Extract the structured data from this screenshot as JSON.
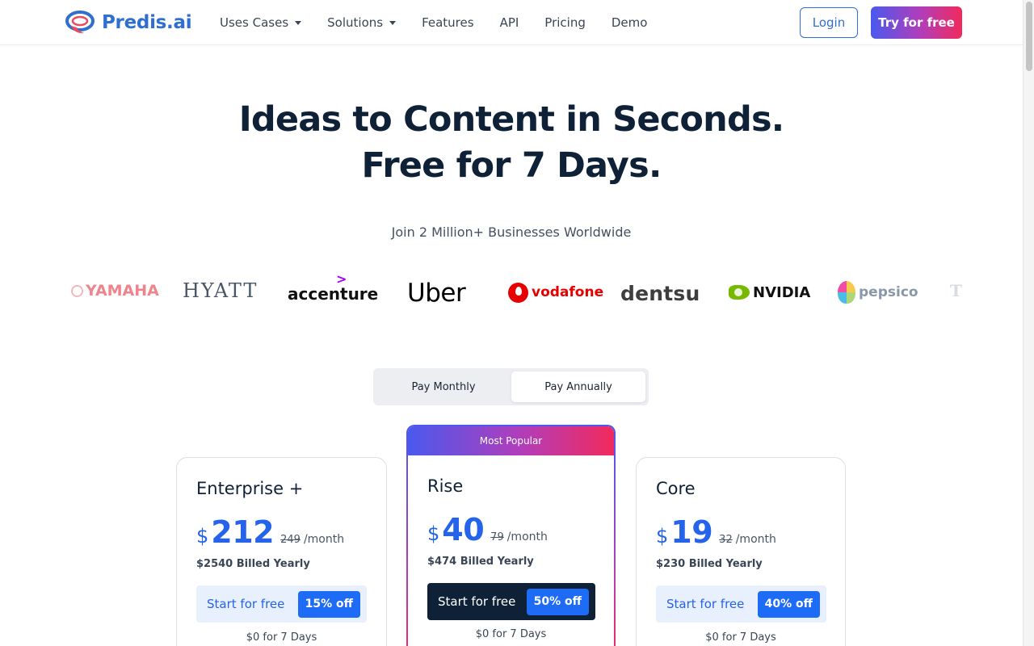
{
  "header": {
    "logo_text": "Predis.ai",
    "nav": [
      {
        "label": "Uses Cases",
        "dropdown": true
      },
      {
        "label": "Solutions",
        "dropdown": true
      },
      {
        "label": "Features",
        "dropdown": false
      },
      {
        "label": "API",
        "dropdown": false
      },
      {
        "label": "Pricing",
        "dropdown": false
      },
      {
        "label": "Demo",
        "dropdown": false
      }
    ],
    "login_label": "Login",
    "try_label": "Try for free"
  },
  "hero": {
    "title_line1": "Ideas to Content in Seconds.",
    "title_line2": "Free for 7 Days.",
    "subtitle": "Join 2 Million+ Businesses Worldwide"
  },
  "brands": {
    "yamaha": "YAMAHA",
    "hyatt": "HYATT",
    "accenture": "accenture",
    "uber": "Uber",
    "vodafone": "vodafone",
    "dentsu": "dentsu",
    "nvidia": "NVIDIA",
    "pepsico": "pepsico",
    "partial": "T"
  },
  "billing": {
    "monthly_label": "Pay Monthly",
    "annual_label": "Pay Annually",
    "selected": "Pay Annually"
  },
  "plans": {
    "enterprise": {
      "name": "Enterprise +",
      "currency": "$",
      "price": "212",
      "old_price": "249",
      "period": "/month",
      "billed": "$2540 Billed Yearly",
      "cta": "Start for free",
      "discount": "15% off",
      "trial": "$0 for 7 Days"
    },
    "rise": {
      "badge": "Most Popular",
      "name": "Rise",
      "currency": "$",
      "price": "40",
      "old_price": "79",
      "period": "/month",
      "billed": "$474 Billed Yearly",
      "cta": "Start for free",
      "discount": "50% off",
      "trial": "$0 for 7 Days"
    },
    "core": {
      "name": "Core",
      "currency": "$",
      "price": "19",
      "old_price": "32",
      "period": "/month",
      "billed": "$230 Billed Yearly",
      "cta": "Start for free",
      "discount": "40% off",
      "trial": "$0 for 7 Days"
    }
  },
  "colors": {
    "brand_blue": "#2563eb",
    "navy": "#0f2137",
    "gradient_start": "#4a59ee",
    "gradient_end": "#f12a5c"
  }
}
